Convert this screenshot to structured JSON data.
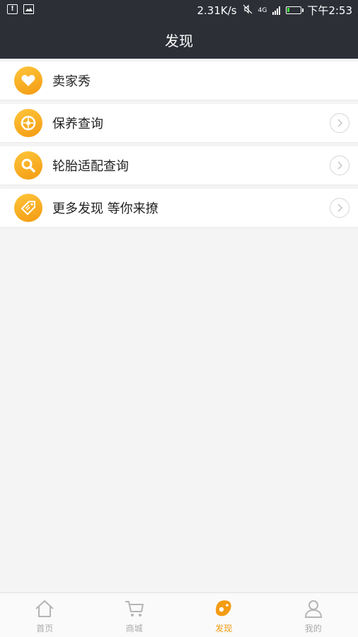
{
  "status_bar": {
    "speed": "2.31K/s",
    "network": "4G",
    "time": "下午2:53"
  },
  "header": {
    "title": "发现"
  },
  "menu": {
    "items": [
      {
        "label": "卖家秀",
        "icon": "heart-icon",
        "has_arrow": false
      },
      {
        "label": "保养查询",
        "icon": "wheel-icon",
        "has_arrow": true
      },
      {
        "label": "轮胎适配查询",
        "icon": "search-icon",
        "has_arrow": true
      },
      {
        "label": "更多发现 等你来撩",
        "icon": "tag-icon",
        "has_arrow": true
      }
    ]
  },
  "tabbar": {
    "items": [
      {
        "label": "首页",
        "icon": "home-icon",
        "active": false
      },
      {
        "label": "商城",
        "icon": "cart-icon",
        "active": false
      },
      {
        "label": "发现",
        "icon": "discover-icon",
        "active": true
      },
      {
        "label": "我的",
        "icon": "user-icon",
        "active": false
      }
    ]
  },
  "colors": {
    "header_bg": "#2c2f36",
    "accent": "#f39b12",
    "page_bg": "#f4f4f4"
  }
}
